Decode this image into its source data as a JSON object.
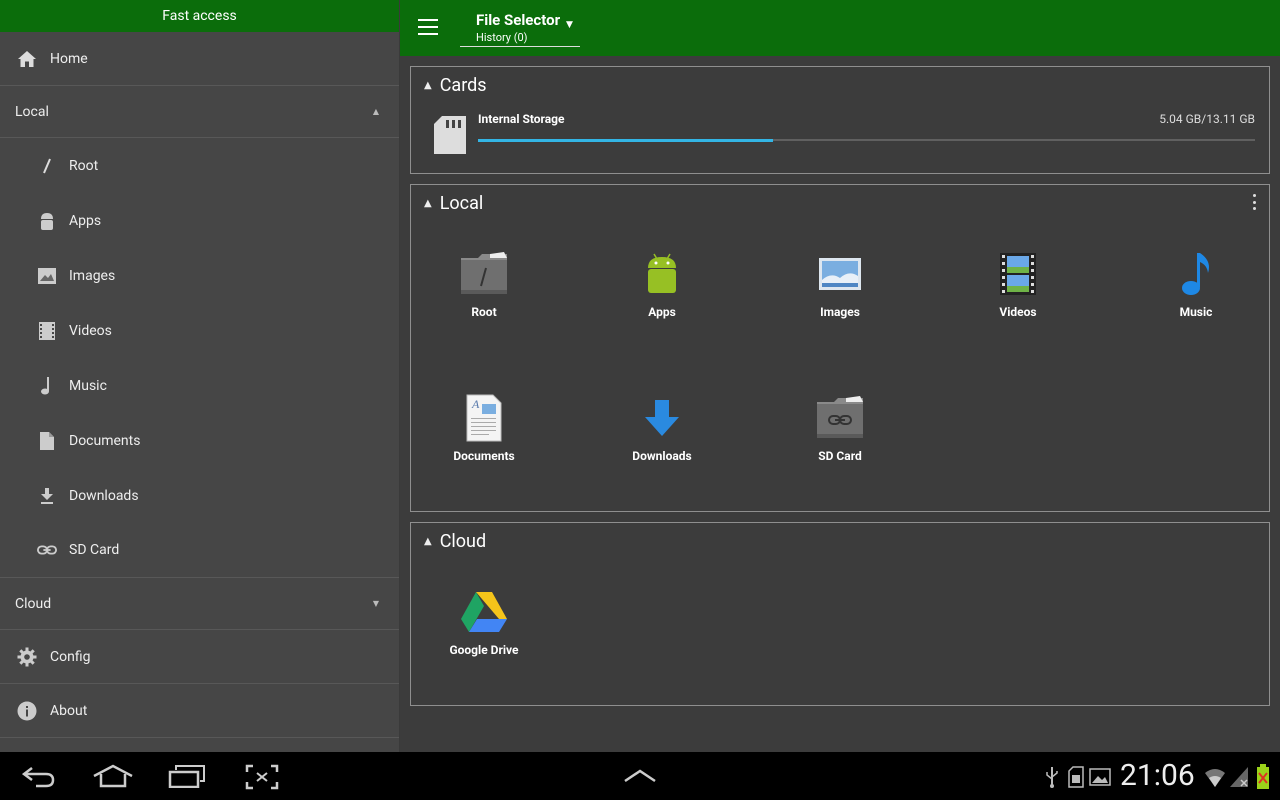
{
  "sidebar": {
    "header": "Fast access",
    "home": "Home",
    "local_section": "Local",
    "local_items": [
      {
        "label": "Root",
        "icon": "slash-icon"
      },
      {
        "label": "Apps",
        "icon": "android-icon"
      },
      {
        "label": "Images",
        "icon": "image-icon"
      },
      {
        "label": "Videos",
        "icon": "film-icon"
      },
      {
        "label": "Music",
        "icon": "music-note-icon"
      },
      {
        "label": "Documents",
        "icon": "document-icon"
      },
      {
        "label": "Downloads",
        "icon": "download-icon"
      },
      {
        "label": "SD Card",
        "icon": "link-icon"
      }
    ],
    "cloud_section": "Cloud",
    "config": "Config",
    "about": "About"
  },
  "topbar": {
    "title": "File Selector",
    "subtitle": "History (0)"
  },
  "cards": {
    "title": "Cards",
    "storage": {
      "name": "Internal Storage",
      "size": "5.04 GB/13.11 GB",
      "used_fraction": 0.38
    }
  },
  "local": {
    "title": "Local",
    "tiles": [
      "Root",
      "Apps",
      "Images",
      "Videos",
      "Music",
      "Documents",
      "Downloads",
      "SD Card"
    ]
  },
  "cloud": {
    "title": "Cloud",
    "tiles": [
      "Google Drive"
    ]
  },
  "system": {
    "clock": "21:06"
  },
  "colors": {
    "accent": "#0b6d0b",
    "progress": "#33b5e5",
    "android_green": "#97c024",
    "music_blue": "#1e88e5"
  }
}
